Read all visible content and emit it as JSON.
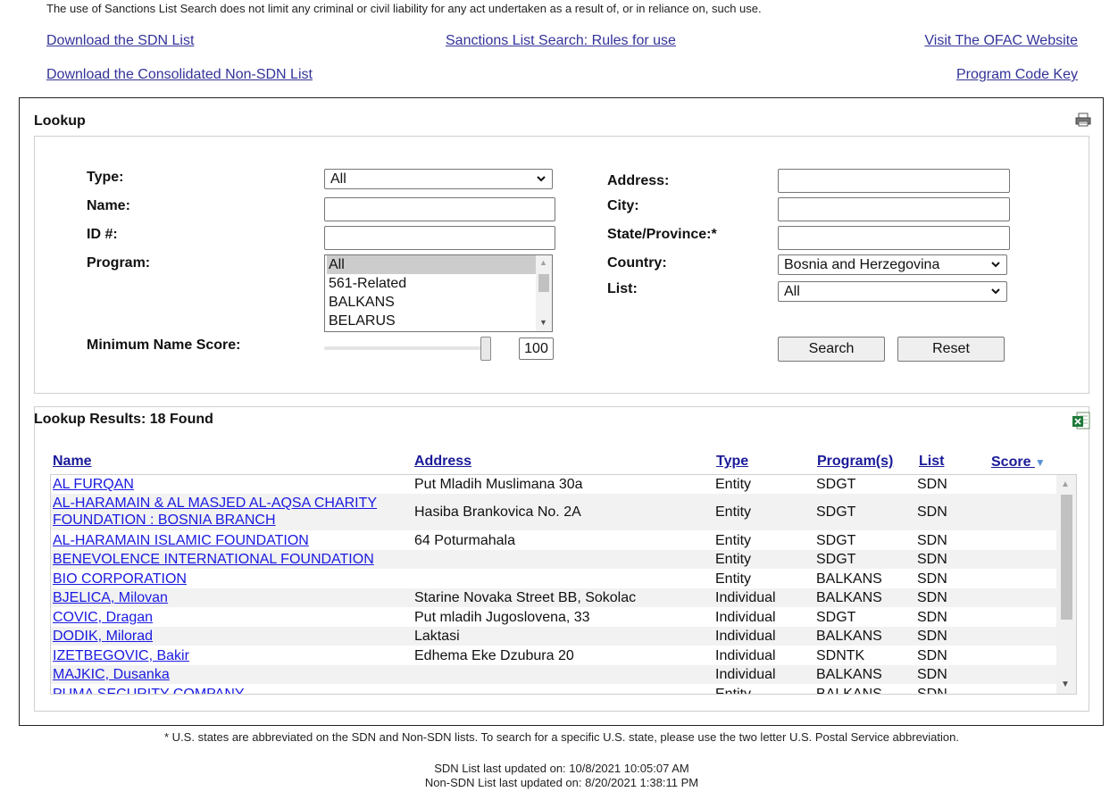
{
  "disclaimer": "The use of Sanctions List Search does not limit any criminal or civil liability for any act undertaken as a result of, or in reliance on, such use.",
  "links": {
    "download_sdn": "Download the SDN List",
    "rules": "Sanctions List Search: Rules for use",
    "visit_ofac": "Visit The OFAC Website",
    "download_consolidated": "Download the Consolidated Non-SDN List",
    "program_code_key": "Program Code Key"
  },
  "lookup": {
    "title": "Lookup",
    "type_label": "Type:",
    "type_value": "All",
    "name_label": "Name:",
    "name_value": "",
    "id_label": "ID #:",
    "id_value": "",
    "program_label": "Program:",
    "program_options": [
      "All",
      "561-Related",
      "BALKANS",
      "BELARUS"
    ],
    "program_selected": "All",
    "min_score_label": "Minimum Name Score:",
    "min_score_value": "100",
    "address_label": "Address:",
    "address_value": "",
    "city_label": "City:",
    "city_value": "",
    "state_label": "State/Province:*",
    "state_value": "",
    "country_label": "Country:",
    "country_value": "Bosnia and Herzegovina",
    "list_label": "List:",
    "list_value": "All",
    "search_button": "Search",
    "reset_button": "Reset"
  },
  "results": {
    "title": "Lookup Results: 18 Found",
    "columns": [
      "Name",
      "Address",
      "Type",
      "Program(s)",
      "List",
      "Score"
    ],
    "rows": [
      {
        "name": "AL FURQAN",
        "address": "Put Mladih Muslimana 30a",
        "type": "Entity",
        "program": "SDGT",
        "list": "SDN"
      },
      {
        "name": "AL-HARAMAIN & AL MASJED AL-AQSA CHARITY FOUNDATION : BOSNIA BRANCH",
        "name_line1": "AL-HARAMAIN & AL MASJED AL-AQSA CHARITY",
        "name_line2": "FOUNDATION : BOSNIA BRANCH",
        "address": "Hasiba Brankovica No. 2A",
        "type": "Entity",
        "program": "SDGT",
        "list": "SDN"
      },
      {
        "name": "AL-HARAMAIN ISLAMIC FOUNDATION",
        "address": "64 Poturmahala",
        "type": "Entity",
        "program": "SDGT",
        "list": "SDN"
      },
      {
        "name": "BENEVOLENCE INTERNATIONAL FOUNDATION",
        "address": "",
        "type": "Entity",
        "program": "SDGT",
        "list": "SDN"
      },
      {
        "name": "BIO CORPORATION",
        "address": "",
        "type": "Entity",
        "program": "BALKANS",
        "list": "SDN"
      },
      {
        "name": "BJELICA, Milovan",
        "address": "Starine Novaka Street BB, Sokolac",
        "type": "Individual",
        "program": "BALKANS",
        "list": "SDN"
      },
      {
        "name": "COVIC, Dragan",
        "address": "Put mladih Jugoslovena, 33",
        "type": "Individual",
        "program": "SDGT",
        "list": "SDN"
      },
      {
        "name": "DODIK, Milorad",
        "address": "Laktasi",
        "type": "Individual",
        "program": "BALKANS",
        "list": "SDN"
      },
      {
        "name": "IZETBEGOVIC, Bakir",
        "address": "Edhema Eke Dzubura 20",
        "type": "Individual",
        "program": "SDNTK",
        "list": "SDN"
      },
      {
        "name": "MAJKIC, Dusanka",
        "address": "",
        "type": "Individual",
        "program": "BALKANS",
        "list": "SDN"
      },
      {
        "name": "PUMA SECURITY COMPANY",
        "address": "",
        "type": "Entity",
        "program": "BALKANS",
        "list": "SDN"
      }
    ]
  },
  "footer": {
    "note": "* U.S. states are abbreviated on the SDN and Non-SDN lists. To search for a specific U.S. state, please use the two letter U.S. Postal Service abbreviation.",
    "sdn_updated": "SDN List last updated on: 10/8/2021 10:05:07 AM",
    "non_sdn_updated": "Non-SDN List last updated on: 8/20/2021 1:38:11 PM"
  },
  "colors": {
    "link": "#333399",
    "result_link": "#1a1ae0",
    "row_alt": "#f2f2f2"
  },
  "icons": [
    "printer-icon",
    "excel-export-icon",
    "sort-desc-icon",
    "chevron-down-icon"
  ]
}
